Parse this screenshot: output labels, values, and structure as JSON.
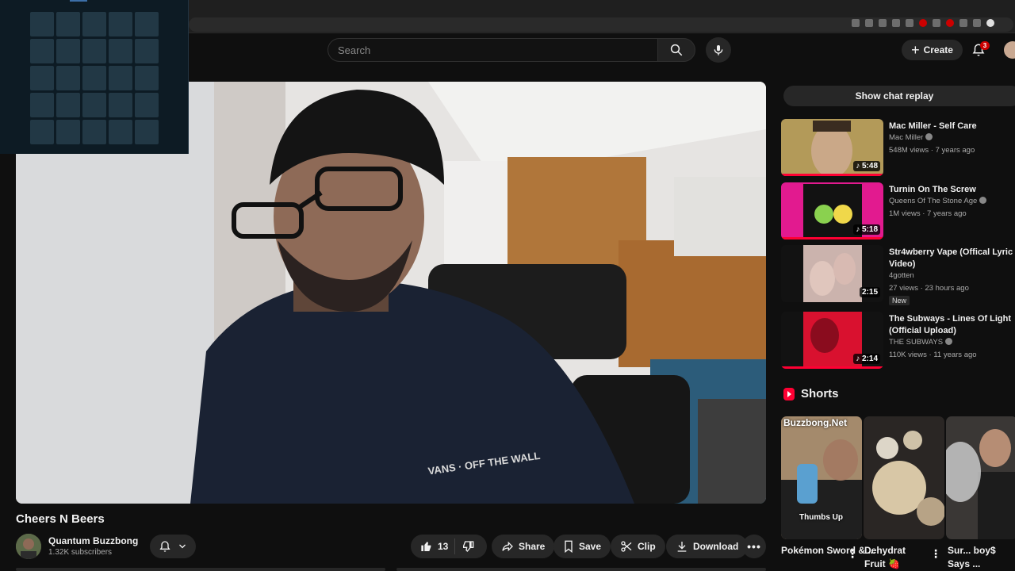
{
  "masthead": {
    "search_placeholder": "Search",
    "create_label": "Create",
    "notification_count": "3"
  },
  "video": {
    "title": "Cheers N Beers",
    "channel_name": "Quantum Buzzbong",
    "subscribers": "1.32K subscribers",
    "likes": "13",
    "actions": {
      "share": "Share",
      "save": "Save",
      "clip": "Clip",
      "download": "Download"
    },
    "shirt_text": "VANS · OFF THE WALL"
  },
  "sidebar": {
    "chat_replay_label": "Show chat replay",
    "recommendations": [
      {
        "title": "Mac Miller - Self Care",
        "channel": "Mac Miller",
        "verified": true,
        "stats": "548M views · 7 years ago",
        "duration": "5:48"
      },
      {
        "title": "Turnin On The Screw",
        "channel": "Queens Of The Stone Age",
        "verified": true,
        "stats": "1M views · 7 years ago",
        "duration": "5:18"
      },
      {
        "title": "Str4wberry Vape (Offical Lyric Video)",
        "channel": "4gotten",
        "verified": false,
        "stats": "27 views · 23 hours ago",
        "badge": "New",
        "duration": "2:15"
      },
      {
        "title": "The Subways - Lines Of Light (Official Upload)",
        "channel": "THE SUBWAYS",
        "verified": true,
        "stats": "110K views · 11 years ago",
        "duration": "2:14"
      }
    ],
    "shorts_heading": "Shorts",
    "shorts": [
      {
        "label": "Pokémon Sword & ...",
        "overlay_top": "Buzzbong.Net",
        "overlay_bottom": "Thumbs Up"
      },
      {
        "label": "Dehydrat Fruit 🍓"
      },
      {
        "label": "Sur... boy$ Says ..."
      }
    ]
  },
  "colors": {
    "background": "#0f0f0f",
    "surface": "#272727",
    "accent_red": "#ff0033"
  }
}
